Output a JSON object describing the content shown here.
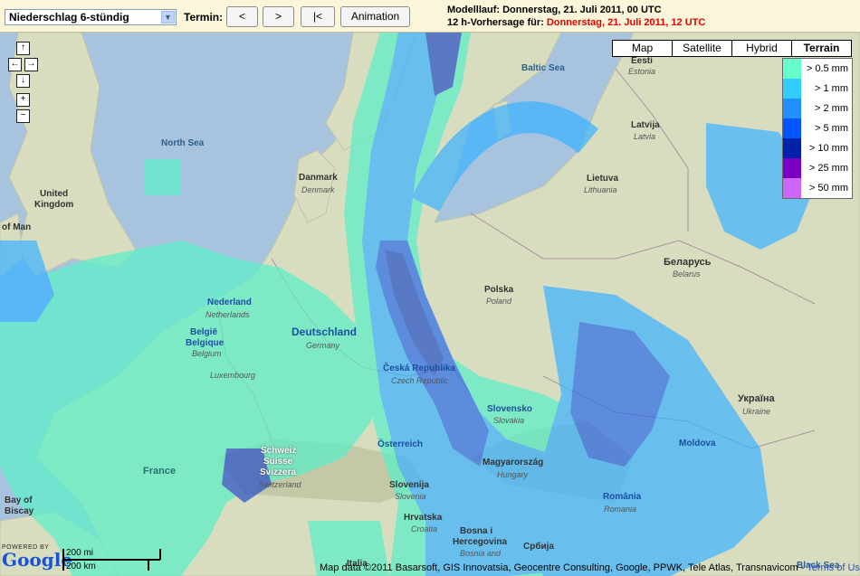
{
  "toolbar": {
    "product_select": "Niederschlag 6-stündig",
    "termin_label": "Termin:",
    "btn_prev": "<",
    "btn_next": ">",
    "btn_first": "|<",
    "btn_animation": "Animation",
    "model_run": "Modelllauf: Donnerstag, 21. Juli 2011, 00 UTC",
    "forecast_prefix": "12 h-Vorhersage für:",
    "forecast_date": "Donnerstag, 21. Juli 2011, 12 UTC"
  },
  "map_types": [
    {
      "label": "Map",
      "active": false
    },
    {
      "label": "Satellite",
      "active": false
    },
    {
      "label": "Hybrid",
      "active": false
    },
    {
      "label": "Terrain",
      "active": true
    }
  ],
  "legend": [
    {
      "label": "> 0.5 mm",
      "color": "#66ffcc"
    },
    {
      "label": "> 1 mm",
      "color": "#33ccff"
    },
    {
      "label": "> 2 mm",
      "color": "#1e90ff"
    },
    {
      "label": "> 5 mm",
      "color": "#0055ff"
    },
    {
      "label": "> 10 mm",
      "color": "#0022aa"
    },
    {
      "label": "> 25 mm",
      "color": "#7a00c8"
    },
    {
      "label": "> 50 mm",
      "color": "#cc66ff"
    }
  ],
  "nav": {
    "up": "↑",
    "left": "←",
    "right": "→",
    "down": "↓",
    "zoom_in": "+",
    "zoom_out": "−"
  },
  "labels": {
    "north_sea": "North Sea",
    "baltic_sea": "Baltic Sea",
    "black_sea": "Black Sea",
    "bay_of_biscay_1": "Bay of",
    "bay_of_biscay_2": "Biscay",
    "eesti": "Eesti",
    "estonia": "Estonia",
    "latvija": "Latvija",
    "latvia": "Latvia",
    "lietuva": "Lietuva",
    "lithuania": "Lithuania",
    "belarus_native": "Беларусь",
    "belarus": "Belarus",
    "ukraina_native": "Україна",
    "ukraine": "Ukraine",
    "moldova": "Moldova",
    "romania": "România",
    "romania_en": "Romania",
    "united_kingdom_1": "United",
    "united_kingdom_2": "Kingdom",
    "isle_of_man": "of Man",
    "danmark": "Danmark",
    "denmark": "Denmark",
    "nederland": "Nederland",
    "netherlands": "Netherlands",
    "belgie": "België",
    "belgique": "Belgique",
    "belgium": "Belgium",
    "luxembourg": "Luxembourg",
    "deutschland": "Deutschland",
    "germany": "Germany",
    "polska": "Polska",
    "poland": "Poland",
    "ceska": "Česká Republika",
    "czech": "Czech Republic",
    "slovensko": "Slovensko",
    "slovakia": "Slovakia",
    "osterreich": "Österreich",
    "magyarorszag": "Magyarország",
    "hungary": "Hungary",
    "schweiz": "Schweiz",
    "suisse": "Suisse",
    "svizzera": "Svizzera",
    "switzerland": "Switzerland",
    "france": "France",
    "slovenija": "Slovenija",
    "slovenia": "Slovenia",
    "hrvatska": "Hrvatska",
    "croatia": "Croatia",
    "bosna_1": "Bosna i",
    "bosna_2": "Hercegovina",
    "bosnia": "Bosnia and",
    "srbija": "Србија",
    "italia": "Italia"
  },
  "scale": {
    "mi": "200 mi",
    "km": "200 km"
  },
  "logo": {
    "powered": "POWERED BY",
    "google": "Google"
  },
  "credit": {
    "text": "Map data ©2011 Basarsoft, GIS Innovatsia, Geocentre Consulting, Google, PPWK, Tele Atlas, Transnavicom - ",
    "terms": "Terms of Use"
  }
}
